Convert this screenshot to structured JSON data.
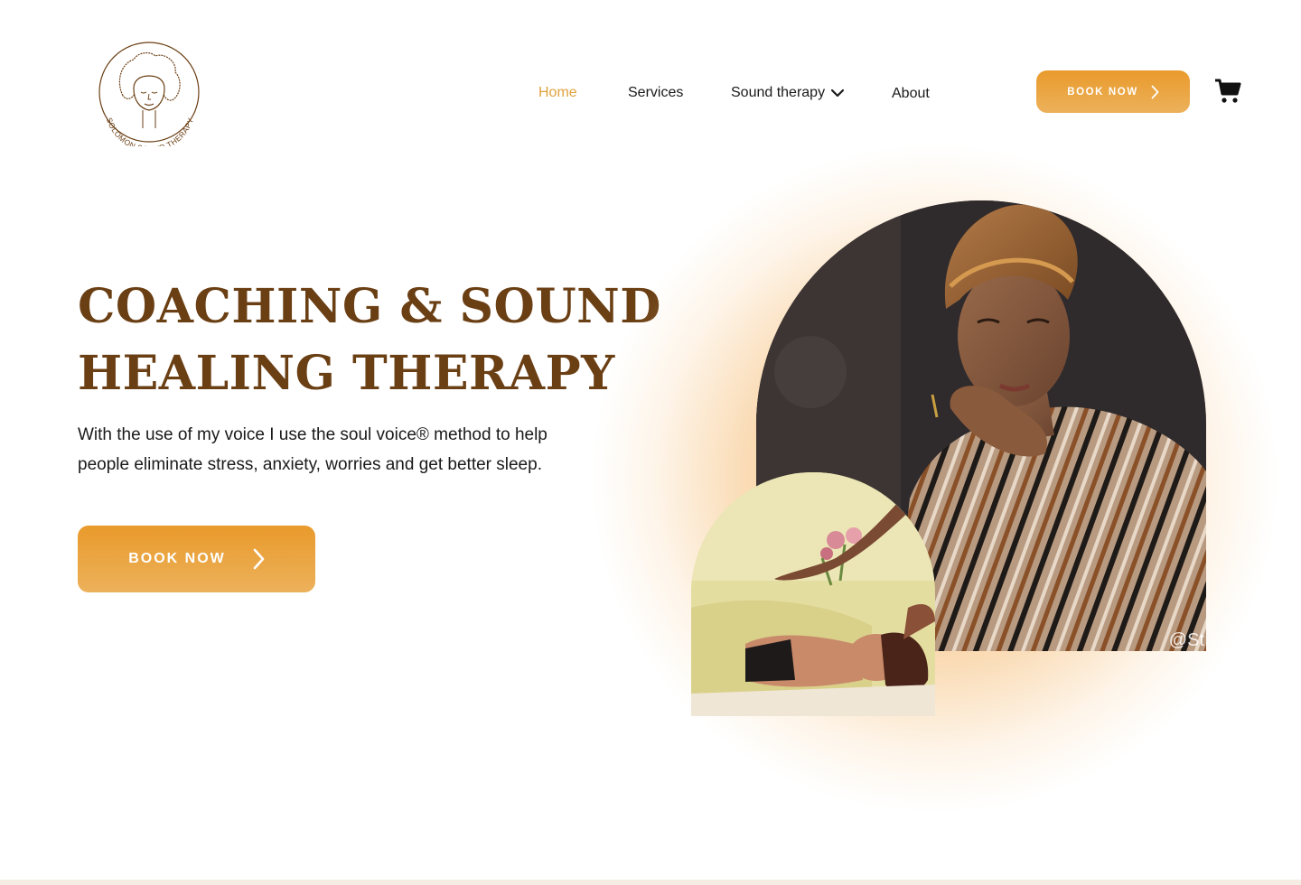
{
  "brand": {
    "logo_text": "SOLOMON SOUND THERAPY",
    "brand_color": "#6b3f14",
    "accent_color": "#e99a2b"
  },
  "nav": {
    "items": [
      {
        "label": "Home",
        "active": true
      },
      {
        "label": "Services",
        "active": false
      },
      {
        "label": "Sound therapy",
        "active": false,
        "has_dropdown": true
      },
      {
        "label": "About",
        "active": false
      }
    ],
    "book_label": "BOOK NOW",
    "cart_icon": "cart-icon"
  },
  "hero": {
    "title_line1": "COACHING & SOUND",
    "title_line2": "HEALING THERAPY",
    "description": "With the use of my voice I use the soul voice® method to help people eliminate stress, anxiety, worries and get better sleep.",
    "cta_label": "BOOK NOW",
    "photo_credit": "@St"
  }
}
